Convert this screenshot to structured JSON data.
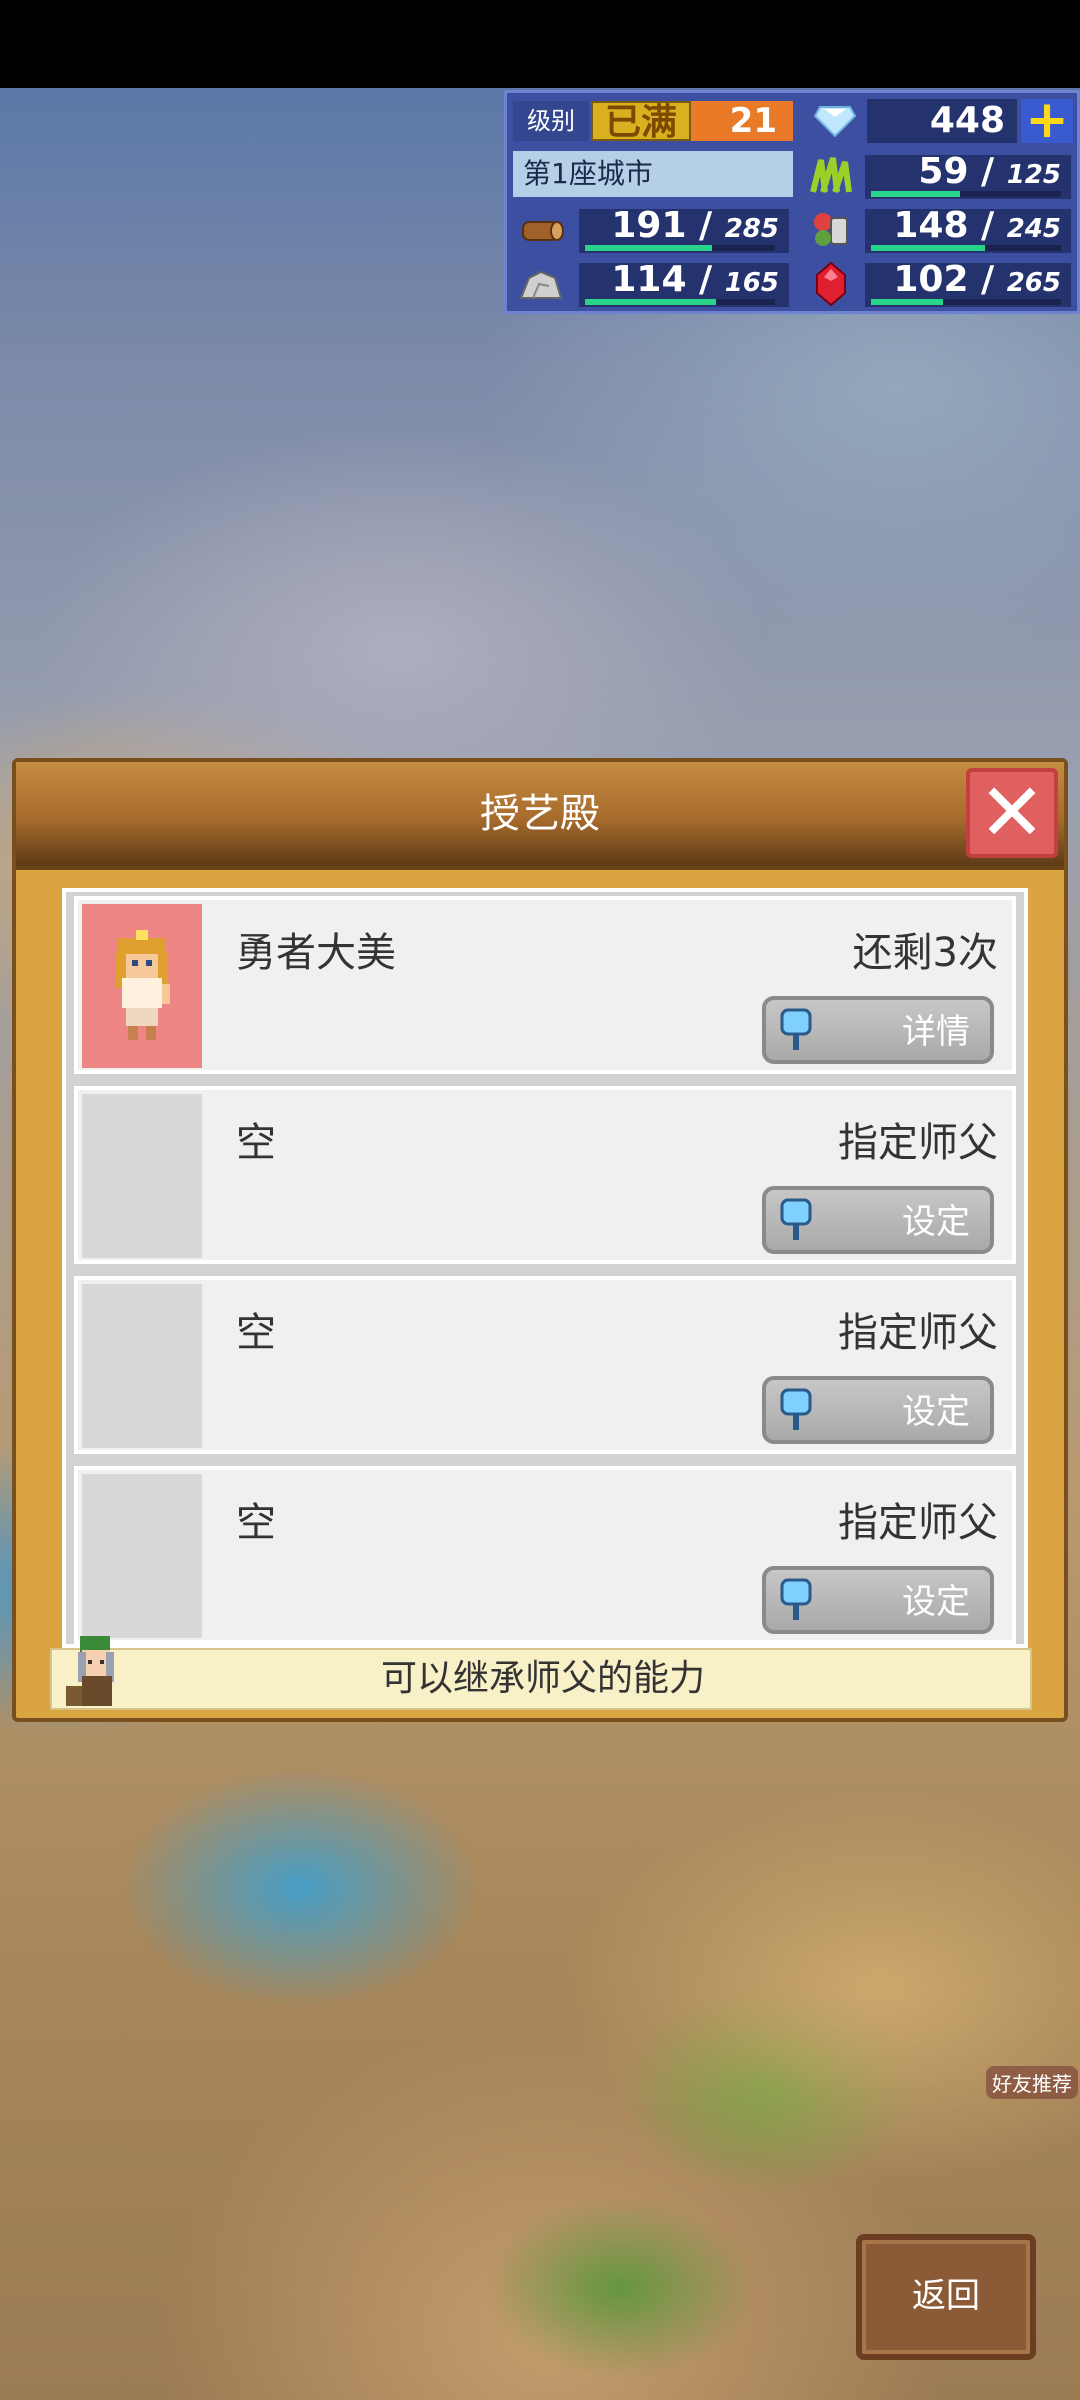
{
  "hud": {
    "level_label": "级别",
    "level_badge": "已满",
    "level_value": "21",
    "gem_value": "448",
    "plus_label": "+",
    "city": "第1座城市",
    "resources": [
      {
        "name": "grass-icon",
        "current": "59",
        "max": "125",
        "fill": 0.47
      },
      {
        "name": "wood-icon",
        "current": "191",
        "max": "285",
        "fill": 0.67
      },
      {
        "name": "food-icon",
        "current": "148",
        "max": "245",
        "fill": 0.6
      },
      {
        "name": "stone-icon",
        "current": "114",
        "max": "165",
        "fill": 0.69
      },
      {
        "name": "ruby-icon",
        "current": "102",
        "max": "265",
        "fill": 0.38
      }
    ]
  },
  "dialog": {
    "title": "授艺殿",
    "slots": [
      {
        "name": "勇者大美",
        "status": "还剩3次",
        "button": "详情",
        "filled": true
      },
      {
        "name": "空",
        "status": "指定师父",
        "button": "设定",
        "filled": false
      },
      {
        "name": "空",
        "status": "指定师父",
        "button": "设定",
        "filled": false
      },
      {
        "name": "空",
        "status": "指定师父",
        "button": "设定",
        "filled": false
      }
    ],
    "footer": "可以继承师父的能力"
  },
  "return_label": "返回",
  "friend_label": "好友推荐"
}
